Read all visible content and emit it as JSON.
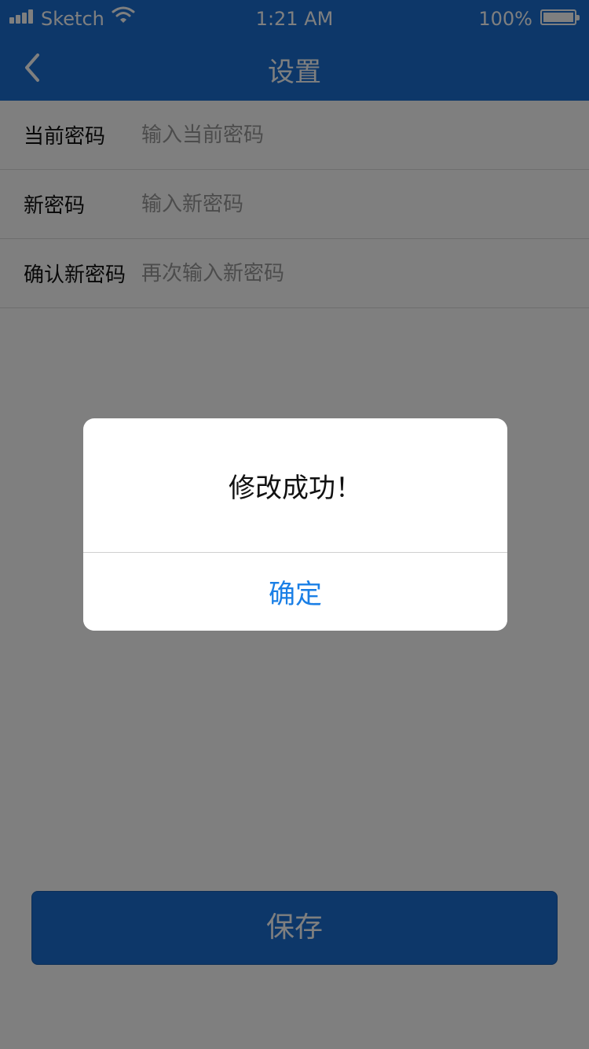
{
  "status_bar": {
    "carrier": "Sketch",
    "time": "1:21 AM",
    "battery": "100%",
    "battery_level": 1.0,
    "signal_icon": "signal-bars-icon",
    "wifi_icon": "wifi-icon"
  },
  "nav": {
    "title": "设置",
    "back_icon": "chevron-left-icon"
  },
  "form": {
    "fields": [
      {
        "label": "当前密码",
        "placeholder": "输入当前密码",
        "value": ""
      },
      {
        "label": "新密码",
        "placeholder": "输入新密码",
        "value": ""
      },
      {
        "label": "确认新密码",
        "placeholder": "再次输入新密码",
        "value": ""
      }
    ]
  },
  "save_button": {
    "label": "保存"
  },
  "dialog": {
    "message": "修改成功！",
    "confirm_label": "确定"
  },
  "colors": {
    "primary": "#1a6fd3",
    "dialog_button": "#1a7fe6",
    "overlay": "rgba(0,0,0,0.5)"
  }
}
